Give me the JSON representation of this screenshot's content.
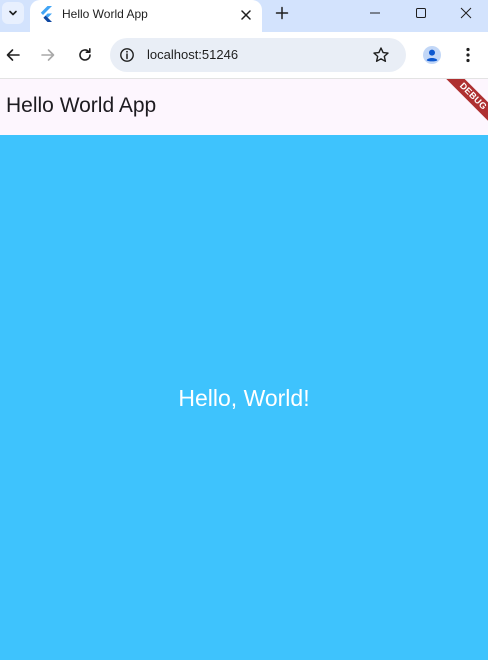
{
  "browser": {
    "tab_title": "Hello World App",
    "url": "localhost:51246"
  },
  "app": {
    "appbar_title": "Hello World App",
    "body_text": "Hello, World!",
    "debug_banner": "DEBUG"
  },
  "icons": {
    "tab_search": "chevron-down-icon",
    "favicon": "flutter-logo-icon",
    "tab_close": "close-icon",
    "new_tab": "plus-icon",
    "minimize": "minimize-icon",
    "maximize": "maximize-icon",
    "close_window": "close-icon",
    "back": "arrow-left-icon",
    "forward": "arrow-right-icon",
    "reload": "reload-icon",
    "site_info": "info-icon",
    "bookmark": "star-icon",
    "profile": "profile-avatar-icon",
    "menu": "kebab-menu-icon"
  },
  "colors": {
    "tabstrip": "#d3e3fd",
    "appbar": "#fdf6fe",
    "body": "#3ec3fd",
    "debug": "#a31515"
  }
}
